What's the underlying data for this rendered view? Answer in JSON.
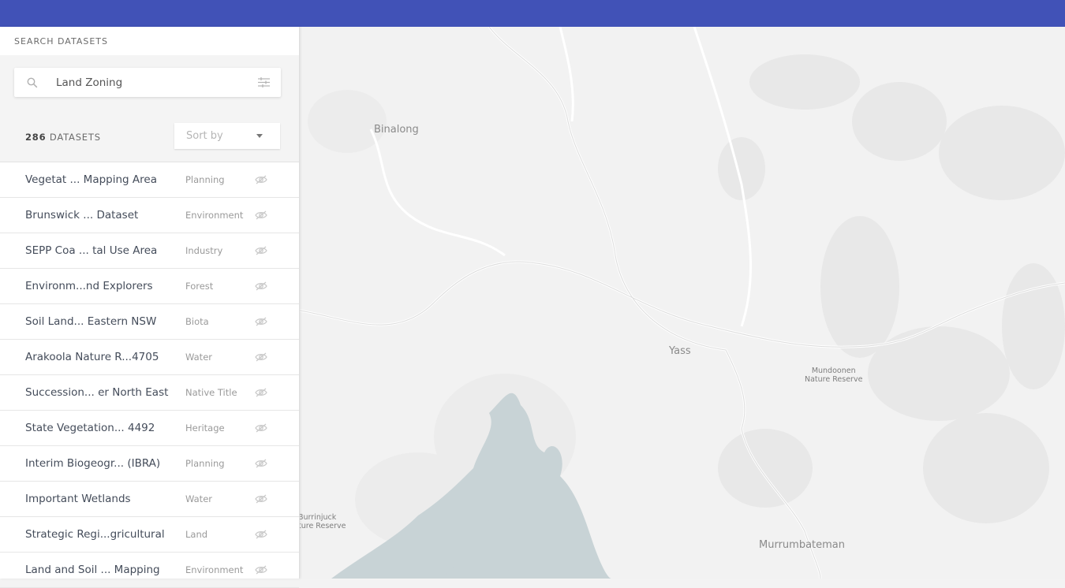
{
  "header": {
    "title": "SEARCH DATASETS"
  },
  "search": {
    "value": "Land Zoning",
    "placeholder": ""
  },
  "results": {
    "count": "286",
    "label": "DATASETS"
  },
  "sort": {
    "label": "Sort by"
  },
  "datasets": [
    {
      "name": "Vegetat ... Mapping Area",
      "category": "Planning"
    },
    {
      "name": "Brunswick ... Dataset",
      "category": "Environment"
    },
    {
      "name": "SEPP Coa ... tal Use Area",
      "category": "Industry"
    },
    {
      "name": "Environm...nd Explorers",
      "category": "Forest"
    },
    {
      "name": "Soil Land... Eastern NSW",
      "category": "Biota"
    },
    {
      "name": "Arakoola Nature R...4705",
      "category": "Water"
    },
    {
      "name": "Succession... er North East",
      "category": "Native Title"
    },
    {
      "name": "State Vegetation... 4492",
      "category": "Heritage"
    },
    {
      "name": "Interim Biogeogr... (IBRA)",
      "category": "Planning"
    },
    {
      "name": "Important Wetlands",
      "category": "Water"
    },
    {
      "name": "Strategic Regi...gricultural",
      "category": "Land"
    },
    {
      "name": "Land and Soil ... Mapping",
      "category": "Environment"
    }
  ],
  "map": {
    "labels": {
      "binalong": "Binalong",
      "yass": "Yass",
      "mundoonen_1": "Mundoonen",
      "mundoonen_2": "Nature Reserve",
      "burrinjuck_1": "Burrinjuck",
      "burrinjuck_2": "ture Reserve",
      "murrumbateman": "Murrumbateman"
    }
  },
  "colors": {
    "topbar": "#4152b7",
    "water": "#c8d3d6",
    "map_bg": "#f2f2f2"
  }
}
